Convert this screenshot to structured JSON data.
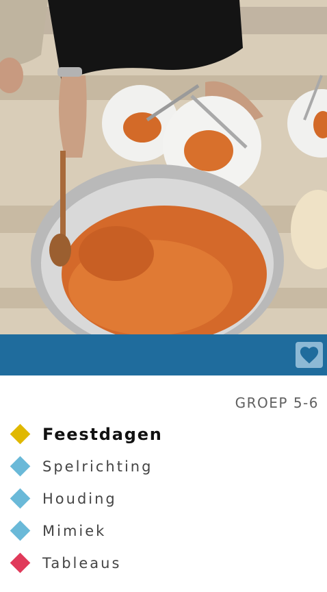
{
  "hero": {
    "image_alt": "Family sharing a platter of rice on the floor"
  },
  "header_band": {
    "color": "#1f6c9d",
    "favorite_icon": "heart-icon"
  },
  "grade": "GROEP 5-6",
  "topics": [
    {
      "label": "Feestdagen",
      "color": "#e0b800",
      "primary": true
    },
    {
      "label": "Spelrichting",
      "color": "#6ab9d8"
    },
    {
      "label": "Houding",
      "color": "#6ab9d8"
    },
    {
      "label": "Mimiek",
      "color": "#6ab9d8"
    },
    {
      "label": "Tableaus",
      "color": "#e03a5a"
    }
  ]
}
